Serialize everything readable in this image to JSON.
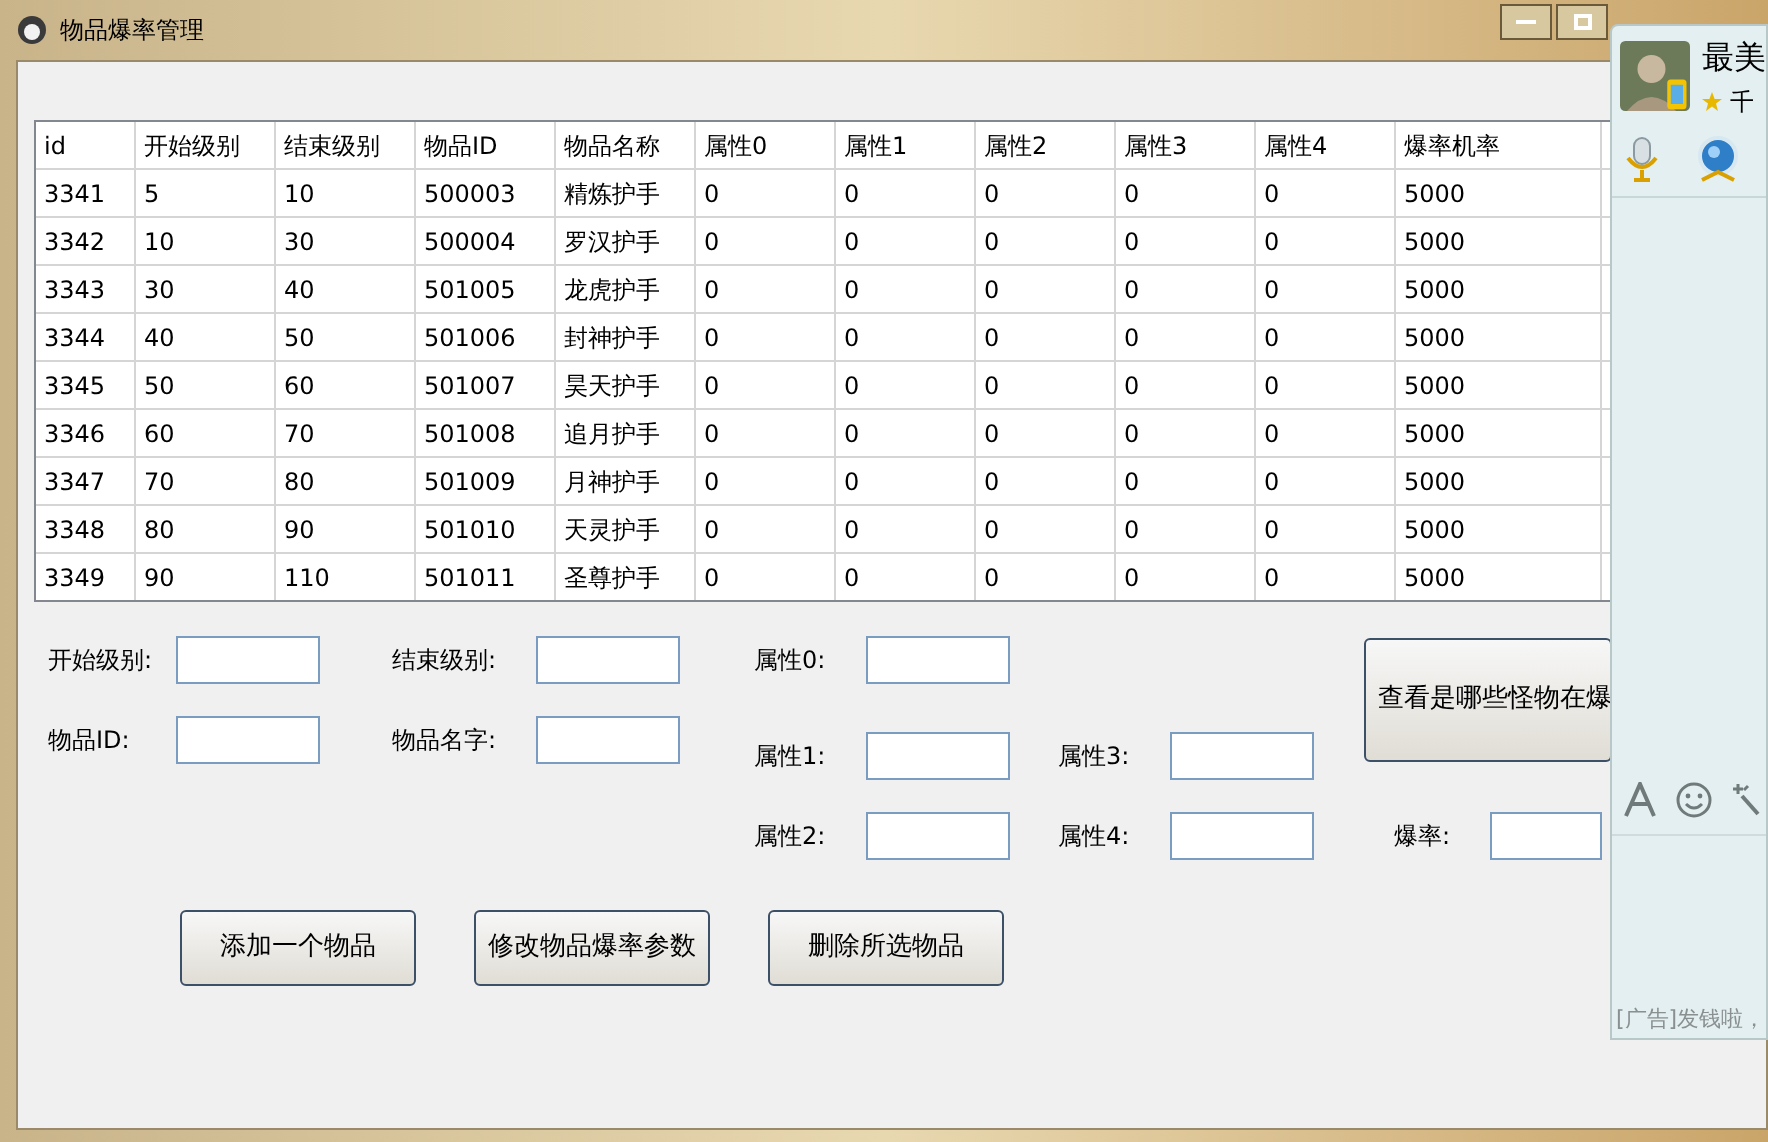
{
  "window": {
    "title": "物品爆率管理"
  },
  "table": {
    "columns": [
      "id",
      "开始级别",
      "结束级别",
      "物品ID",
      "物品名称",
      "属性0",
      "属性1",
      "属性2",
      "属性3",
      "属性4",
      "爆率机率"
    ],
    "rows": [
      [
        "3341",
        "5",
        "10",
        "500003",
        "精炼护手",
        "0",
        "0",
        "0",
        "0",
        "0",
        "5000"
      ],
      [
        "3342",
        "10",
        "30",
        "500004",
        "罗汉护手",
        "0",
        "0",
        "0",
        "0",
        "0",
        "5000"
      ],
      [
        "3343",
        "30",
        "40",
        "501005",
        "龙虎护手",
        "0",
        "0",
        "0",
        "0",
        "0",
        "5000"
      ],
      [
        "3344",
        "40",
        "50",
        "501006",
        "封神护手",
        "0",
        "0",
        "0",
        "0",
        "0",
        "5000"
      ],
      [
        "3345",
        "50",
        "60",
        "501007",
        "昊天护手",
        "0",
        "0",
        "0",
        "0",
        "0",
        "5000"
      ],
      [
        "3346",
        "60",
        "70",
        "501008",
        "追月护手",
        "0",
        "0",
        "0",
        "0",
        "0",
        "5000"
      ],
      [
        "3347",
        "70",
        "80",
        "501009",
        "月神护手",
        "0",
        "0",
        "0",
        "0",
        "0",
        "5000"
      ],
      [
        "3348",
        "80",
        "90",
        "501010",
        "天灵护手",
        "0",
        "0",
        "0",
        "0",
        "0",
        "5000"
      ],
      [
        "3349",
        "90",
        "110",
        "501011",
        "圣尊护手",
        "0",
        "0",
        "0",
        "0",
        "0",
        "5000"
      ]
    ]
  },
  "form": {
    "start_level": "开始级别:",
    "end_level": "结束级别:",
    "item_id": "物品ID:",
    "item_name": "物品名字:",
    "attr0": "属性0:",
    "attr1": "属性1:",
    "attr2": "属性2:",
    "attr3": "属性3:",
    "attr4": "属性4:",
    "drop_rate": "爆率:",
    "view_button": "查看是哪些怪物在爆"
  },
  "buttons": [
    "添加一个物品",
    "修改物品爆率参数",
    "删除所选物品"
  ],
  "chat_window": {
    "contact_name": "最美",
    "status_text": "千",
    "ad_text": "[广告]发钱啦，"
  }
}
